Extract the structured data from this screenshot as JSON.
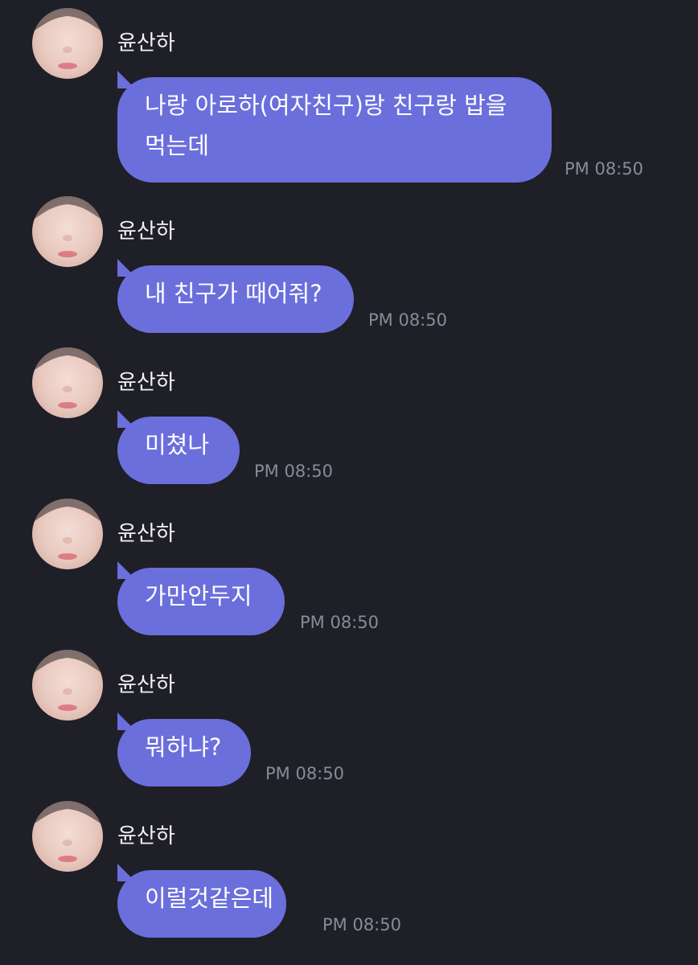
{
  "messages": [
    {
      "sender": "윤산하",
      "text": "나랑 아로하(여자친구)랑 친구랑 밥을\n먹는데",
      "time": "PM 08:50"
    },
    {
      "sender": "윤산하",
      "text": "내 친구가 때어줘?",
      "time": "PM 08:50"
    },
    {
      "sender": "윤산하",
      "text": "미쳤나",
      "time": "PM 08:50"
    },
    {
      "sender": "윤산하",
      "text": "가만안두지",
      "time": "PM 08:50"
    },
    {
      "sender": "윤산하",
      "text": "뭐하냐?",
      "time": "PM 08:50"
    },
    {
      "sender": "윤산하",
      "text": "이럴것같은데",
      "time": "PM 08:50"
    }
  ],
  "colors": {
    "background": "#1f1f28",
    "bubble": "#6b6fdc",
    "timestamp": "#8a8a98",
    "text": "#ffffff"
  },
  "icons": {
    "avatar": "profile-photo"
  }
}
